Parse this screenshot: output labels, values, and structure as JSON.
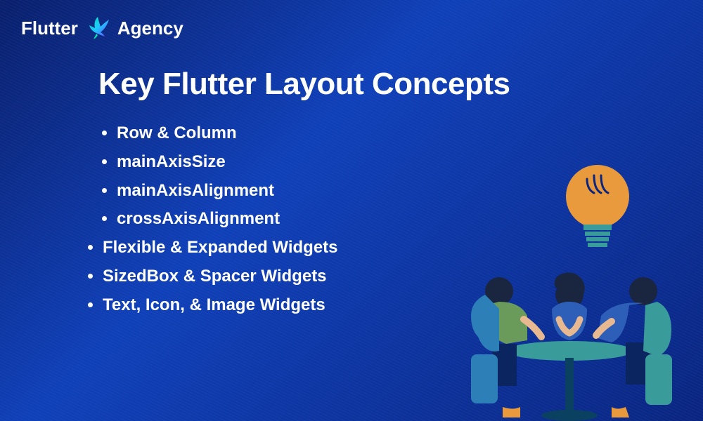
{
  "logo": {
    "text_left": "Flutter",
    "text_right": "Agency"
  },
  "title": "Key Flutter Layout Concepts",
  "bullets": [
    "Row & Column",
    "mainAxisSize",
    "mainAxisAlignment",
    "crossAxisAlignment",
    "Flexible & Expanded Widgets",
    "SizedBox & Spacer Widgets",
    "Text, Icon, & Image Widgets"
  ],
  "colors": {
    "accent_orange": "#e89a3c",
    "accent_teal": "#3a9b9b",
    "accent_blue": "#2d5fb8"
  }
}
